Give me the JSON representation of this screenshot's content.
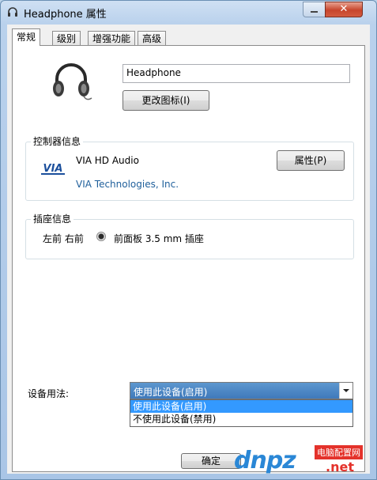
{
  "window": {
    "title": "Headphone 属性",
    "close_label": "✕"
  },
  "tabs": [
    {
      "label": "常规",
      "active": true
    },
    {
      "label": "级别",
      "active": false
    },
    {
      "label": "增强功能",
      "active": false
    },
    {
      "label": "高级",
      "active": false
    }
  ],
  "device": {
    "name": "Headphone",
    "change_icon_label": "更改图标(I)"
  },
  "controller": {
    "group_title": "控制器信息",
    "name": "VIA HD Audio",
    "vendor": "VIA Technologies, Inc.",
    "properties_label": "属性(P)",
    "logo_text": "VIA"
  },
  "jack": {
    "group_title": "插座信息",
    "channels": "左前 右前",
    "description": "前面板 3.5 mm 插座"
  },
  "usage": {
    "label": "设备用法:",
    "selected": "使用此设备(启用)",
    "options": [
      "使用此设备(启用)",
      "不使用此设备(禁用)"
    ]
  },
  "footer": {
    "ok_label": "确定"
  },
  "watermark": {
    "site": "dnpz",
    "tag": "电脑配置网",
    "ext": ".net"
  },
  "colors": {
    "selection": "#3399ff",
    "vendor_text": "#1f5f9b",
    "close_button": "#c7452c"
  }
}
